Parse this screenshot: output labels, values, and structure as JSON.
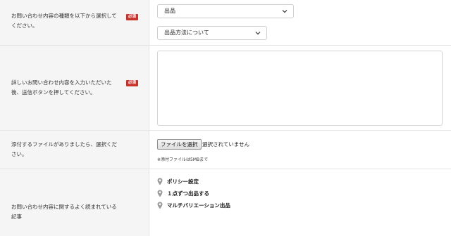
{
  "rows": {
    "inquiry_type": {
      "label_line1": "お問い合わせ内容の種類を以下から選択して",
      "label_line2": "ください。",
      "required_badge": "必須",
      "select1_value": "出品",
      "select2_value": "出品方法について"
    },
    "details": {
      "label_line1": "詳しいお問い合わせ内容を入力いただいた",
      "label_line2": "後、送信ボタンを押してください。",
      "required_badge": "必須",
      "textarea_value": ""
    },
    "attachment": {
      "label_line1": "添付するファイルがありましたら、選択くだ",
      "label_line2": "さい。",
      "file_button": "ファイルを選択",
      "file_status": "選択されていません",
      "note": "※添付ファイルは5MBまで"
    },
    "faq": {
      "label_line1": "お問い合わせ内容に関するよく読まれている",
      "label_line2": "記事",
      "links": [
        "ポリシー設定",
        "１点ずつ出品する",
        "マルチバリエーション出品"
      ]
    }
  },
  "icons": {
    "chevron": "chevron-down-icon",
    "faq_marker": "map-pin-icon"
  },
  "colors": {
    "required_badge_bg": "#c9322b",
    "label_bg": "#f5f5f5",
    "pin_color": "#9a9a9a"
  }
}
